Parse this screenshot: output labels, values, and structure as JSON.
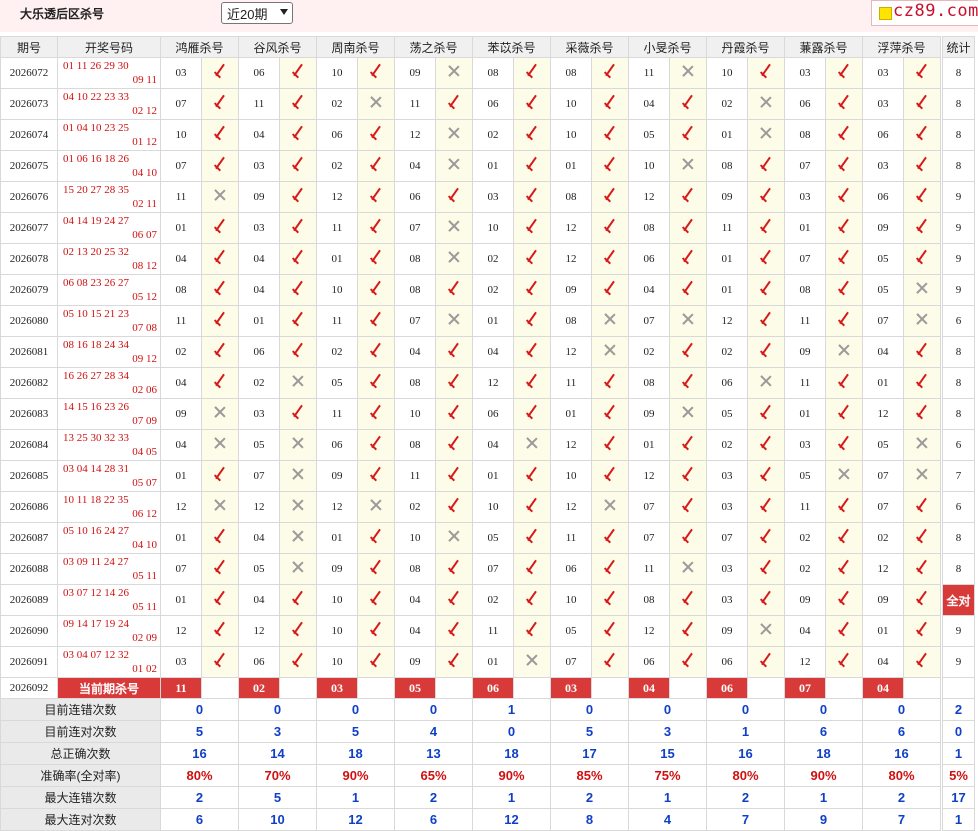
{
  "header": {
    "title": "大乐透后区杀号",
    "range_select": "近20期",
    "logo_text": "cz89.com"
  },
  "columns": {
    "period": "期号",
    "draw": "开奖号码",
    "stat": "统计",
    "experts": [
      "鸿雁杀号",
      "谷风杀号",
      "周南杀号",
      "荡之杀号",
      "苯苡杀号",
      "采薇杀号",
      "小旻杀号",
      "丹霞杀号",
      "蒹露杀号",
      "浮萍杀号"
    ]
  },
  "rows": [
    {
      "period": "2026072",
      "front": "01 11 26 29 30",
      "back": "09 11",
      "kills": [
        "03",
        "06",
        "10",
        "09",
        "08",
        "08",
        "11",
        "10",
        "03",
        "03"
      ],
      "ok": [
        1,
        1,
        1,
        0,
        1,
        1,
        0,
        1,
        1,
        1
      ],
      "count": "8"
    },
    {
      "period": "2026073",
      "front": "04 10 22 23 33",
      "back": "02 12",
      "kills": [
        "07",
        "11",
        "02",
        "11",
        "06",
        "10",
        "04",
        "02",
        "06",
        "03"
      ],
      "ok": [
        1,
        1,
        0,
        1,
        1,
        1,
        1,
        0,
        1,
        1
      ],
      "count": "8"
    },
    {
      "period": "2026074",
      "front": "01 04 10 23 25",
      "back": "01 12",
      "kills": [
        "10",
        "04",
        "06",
        "12",
        "02",
        "10",
        "05",
        "01",
        "08",
        "06"
      ],
      "ok": [
        1,
        1,
        1,
        0,
        1,
        1,
        1,
        0,
        1,
        1
      ],
      "count": "8"
    },
    {
      "period": "2026075",
      "front": "01 06 16 18 26",
      "back": "04 10",
      "kills": [
        "07",
        "03",
        "02",
        "04",
        "01",
        "01",
        "10",
        "08",
        "07",
        "03"
      ],
      "ok": [
        1,
        1,
        1,
        0,
        1,
        1,
        0,
        1,
        1,
        1
      ],
      "count": "8"
    },
    {
      "period": "2026076",
      "front": "15 20 27 28 35",
      "back": "02 11",
      "kills": [
        "11",
        "09",
        "12",
        "06",
        "03",
        "08",
        "12",
        "09",
        "03",
        "06"
      ],
      "ok": [
        0,
        1,
        1,
        1,
        1,
        1,
        1,
        1,
        1,
        1
      ],
      "count": "9"
    },
    {
      "period": "2026077",
      "front": "04 14 19 24 27",
      "back": "06 07",
      "kills": [
        "01",
        "03",
        "11",
        "07",
        "10",
        "12",
        "08",
        "11",
        "01",
        "09"
      ],
      "ok": [
        1,
        1,
        1,
        0,
        1,
        1,
        1,
        1,
        1,
        1
      ],
      "count": "9"
    },
    {
      "period": "2026078",
      "front": "02 13 20 25 32",
      "back": "08 12",
      "kills": [
        "04",
        "04",
        "01",
        "08",
        "02",
        "12",
        "06",
        "01",
        "07",
        "05"
      ],
      "ok": [
        1,
        1,
        1,
        0,
        1,
        1,
        1,
        1,
        1,
        1
      ],
      "count": "9"
    },
    {
      "period": "2026079",
      "front": "06 08 23 26 27",
      "back": "05 12",
      "kills": [
        "08",
        "04",
        "10",
        "08",
        "02",
        "09",
        "04",
        "01",
        "08",
        "05"
      ],
      "ok": [
        1,
        1,
        1,
        1,
        1,
        1,
        1,
        1,
        1,
        0
      ],
      "count": "9"
    },
    {
      "period": "2026080",
      "front": "05 10 15 21 23",
      "back": "07 08",
      "kills": [
        "11",
        "01",
        "11",
        "07",
        "01",
        "08",
        "07",
        "12",
        "11",
        "07"
      ],
      "ok": [
        1,
        1,
        1,
        0,
        1,
        0,
        0,
        1,
        1,
        0
      ],
      "count": "6"
    },
    {
      "period": "2026081",
      "front": "08 16 18 24 34",
      "back": "09 12",
      "kills": [
        "02",
        "06",
        "02",
        "04",
        "04",
        "12",
        "02",
        "02",
        "09",
        "04"
      ],
      "ok": [
        1,
        1,
        1,
        1,
        1,
        0,
        1,
        1,
        0,
        1
      ],
      "count": "8"
    },
    {
      "period": "2026082",
      "front": "16 26 27 28 34",
      "back": "02 06",
      "kills": [
        "04",
        "02",
        "05",
        "08",
        "12",
        "11",
        "08",
        "06",
        "11",
        "01"
      ],
      "ok": [
        1,
        0,
        1,
        1,
        1,
        1,
        1,
        0,
        1,
        1
      ],
      "count": "8"
    },
    {
      "period": "2026083",
      "front": "14 15 16 23 26",
      "back": "07 09",
      "kills": [
        "09",
        "03",
        "11",
        "10",
        "06",
        "01",
        "09",
        "05",
        "01",
        "12"
      ],
      "ok": [
        0,
        1,
        1,
        1,
        1,
        1,
        0,
        1,
        1,
        1
      ],
      "count": "8"
    },
    {
      "period": "2026084",
      "front": "13 25 30 32 33",
      "back": "04 05",
      "kills": [
        "04",
        "05",
        "06",
        "08",
        "04",
        "12",
        "01",
        "02",
        "03",
        "05"
      ],
      "ok": [
        0,
        0,
        1,
        1,
        0,
        1,
        1,
        1,
        1,
        0
      ],
      "count": "6"
    },
    {
      "period": "2026085",
      "front": "03 04 14 28 31",
      "back": "05 07",
      "kills": [
        "01",
        "07",
        "09",
        "11",
        "01",
        "10",
        "12",
        "03",
        "05",
        "07"
      ],
      "ok": [
        1,
        0,
        1,
        1,
        1,
        1,
        1,
        1,
        0,
        0
      ],
      "count": "7"
    },
    {
      "period": "2026086",
      "front": "10 11 18 22 35",
      "back": "06 12",
      "kills": [
        "12",
        "12",
        "12",
        "02",
        "10",
        "12",
        "07",
        "03",
        "11",
        "07"
      ],
      "ok": [
        0,
        0,
        0,
        1,
        1,
        0,
        1,
        1,
        1,
        1
      ],
      "count": "6"
    },
    {
      "period": "2026087",
      "front": "05 10 16 24 27",
      "back": "04 10",
      "kills": [
        "01",
        "04",
        "01",
        "10",
        "05",
        "11",
        "07",
        "07",
        "02",
        "02"
      ],
      "ok": [
        1,
        0,
        1,
        0,
        1,
        1,
        1,
        1,
        1,
        1
      ],
      "count": "8"
    },
    {
      "period": "2026088",
      "front": "03 09 11 24 27",
      "back": "05 11",
      "kills": [
        "07",
        "05",
        "09",
        "08",
        "07",
        "06",
        "11",
        "03",
        "02",
        "12"
      ],
      "ok": [
        1,
        0,
        1,
        1,
        1,
        1,
        0,
        1,
        1,
        1
      ],
      "count": "8"
    },
    {
      "period": "2026089",
      "front": "03 07 12 14 26",
      "back": "05 11",
      "kills": [
        "01",
        "04",
        "10",
        "04",
        "02",
        "10",
        "08",
        "03",
        "09",
        "09"
      ],
      "ok": [
        1,
        1,
        1,
        1,
        1,
        1,
        1,
        1,
        1,
        1
      ],
      "count": "全对"
    },
    {
      "period": "2026090",
      "front": "09 14 17 19 24",
      "back": "02 09",
      "kills": [
        "12",
        "12",
        "10",
        "04",
        "11",
        "05",
        "12",
        "09",
        "04",
        "01"
      ],
      "ok": [
        1,
        1,
        1,
        1,
        1,
        1,
        1,
        0,
        1,
        1
      ],
      "count": "9"
    },
    {
      "period": "2026091",
      "front": "03 04 07 12 32",
      "back": "01 02",
      "kills": [
        "03",
        "06",
        "10",
        "09",
        "01",
        "07",
        "06",
        "06",
        "12",
        "04"
      ],
      "ok": [
        1,
        1,
        1,
        1,
        0,
        1,
        1,
        1,
        1,
        1
      ],
      "count": "9"
    }
  ],
  "current": {
    "period": "2026092",
    "label": "当前期杀号",
    "kills": [
      "11",
      "02",
      "03",
      "05",
      "06",
      "03",
      "04",
      "06",
      "07",
      "04"
    ]
  },
  "stats": [
    {
      "label": "目前连错次数",
      "values": [
        "0",
        "0",
        "0",
        "0",
        "1",
        "0",
        "0",
        "0",
        "0",
        "0"
      ],
      "total": "2",
      "color": "blue"
    },
    {
      "label": "目前连对次数",
      "values": [
        "5",
        "3",
        "5",
        "4",
        "0",
        "5",
        "3",
        "1",
        "6",
        "6"
      ],
      "total": "0",
      "color": "blue"
    },
    {
      "label": "总正确次数",
      "values": [
        "16",
        "14",
        "18",
        "13",
        "18",
        "17",
        "15",
        "16",
        "18",
        "16"
      ],
      "total": "1",
      "color": "blue"
    },
    {
      "label": "准确率(全对率)",
      "values": [
        "80%",
        "70%",
        "90%",
        "65%",
        "90%",
        "85%",
        "75%",
        "80%",
        "90%",
        "80%"
      ],
      "total": "5%",
      "color": "red"
    },
    {
      "label": "最大连错次数",
      "values": [
        "2",
        "5",
        "1",
        "2",
        "1",
        "2",
        "1",
        "2",
        "1",
        "2"
      ],
      "total": "17",
      "color": "blue"
    },
    {
      "label": "最大连对次数",
      "values": [
        "6",
        "10",
        "12",
        "6",
        "12",
        "8",
        "4",
        "7",
        "9",
        "7"
      ],
      "total": "1",
      "color": "blue"
    }
  ],
  "colors": {
    "accent": "#d83a3a",
    "ok": "#d61a1a",
    "bad": "#9a9a9a",
    "blue": "#1040c8"
  }
}
